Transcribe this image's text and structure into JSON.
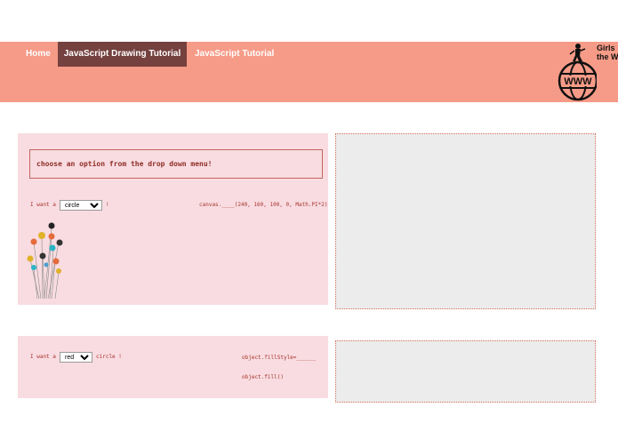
{
  "nav": {
    "home": "Home",
    "drawing_tutorial": "JavaScript Drawing Tutorial",
    "js_tutorial": "JavaScript Tutorial",
    "logo_text": "Girls\nthe W",
    "logo_globe_text": "WWW"
  },
  "section1": {
    "prompt": "choose an option from the drop down menu!",
    "want_prefix": "I want a",
    "shape_selected": "circle",
    "want_suffix": "!",
    "code": "canvas.____(240, 160, 100, 0, Math.PI*2)"
  },
  "section2": {
    "want_prefix": "I want a",
    "color_selected": "red",
    "want_suffix": "circle !",
    "code_line1": "object.fillStyle=______",
    "code_line2": "object.fill()"
  },
  "colors": {
    "nav_bg": "#f69b87",
    "nav_active": "#74413f",
    "panel_pink": "#f8dce1",
    "canvas_grey": "#ececec",
    "text_red": "#a8342b"
  }
}
